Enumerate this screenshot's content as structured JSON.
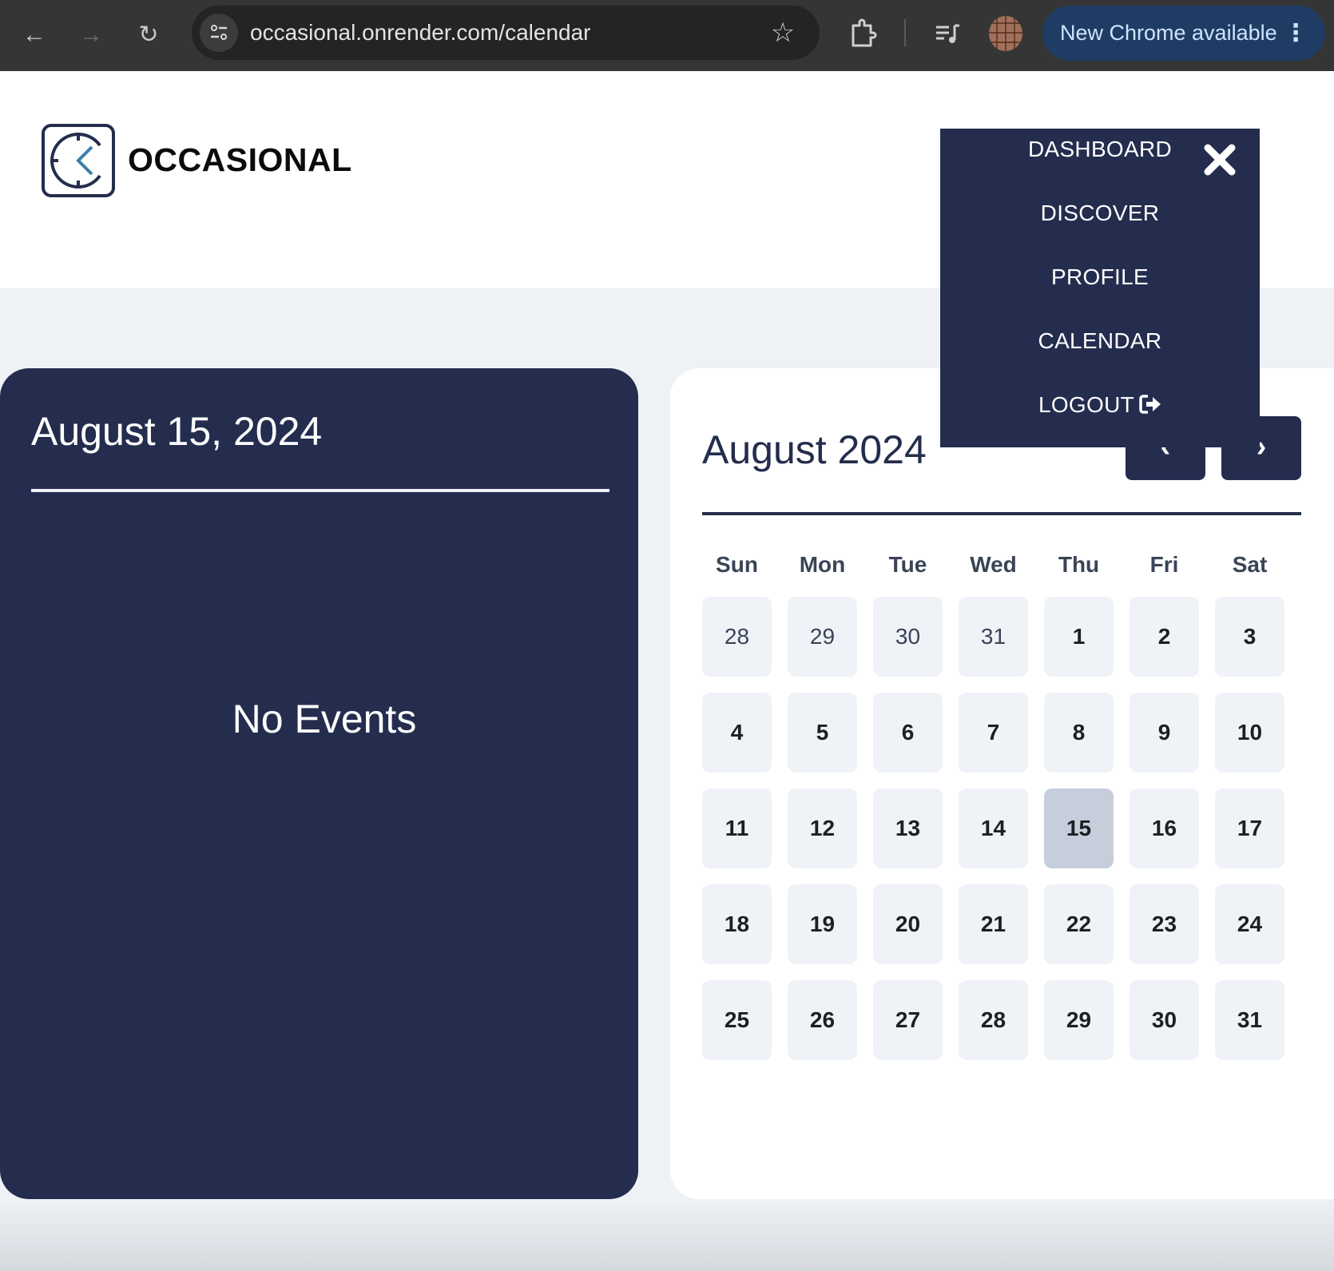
{
  "browser": {
    "url": "occasional.onrender.com/calendar",
    "update_label": "New Chrome available",
    "icons": [
      "back-icon",
      "forward-icon",
      "reload-icon",
      "site-info-icon",
      "bookmark-star-icon",
      "extensions-icon",
      "media-control-icon",
      "profile-avatar",
      "more-icon"
    ]
  },
  "header": {
    "brand": "OCCASIONAL"
  },
  "menu": {
    "items": [
      {
        "label": "DASHBOARD"
      },
      {
        "label": "DISCOVER"
      },
      {
        "label": "PROFILE"
      },
      {
        "label": "CALENDAR"
      },
      {
        "label": "LOGOUT"
      }
    ],
    "close_icon": "close-icon",
    "logout_icon": "sign-out-icon"
  },
  "day_panel": {
    "selected_date": "August 15, 2024",
    "empty_message": "No Events"
  },
  "calendar": {
    "month_title": "August 2024",
    "prev_label": "‹",
    "next_label": "›",
    "weekdays": [
      "Sun",
      "Mon",
      "Tue",
      "Wed",
      "Thu",
      "Fri",
      "Sat"
    ],
    "selected_day": 15,
    "weeks": [
      [
        {
          "d": "28",
          "out": true
        },
        {
          "d": "29",
          "out": true
        },
        {
          "d": "30",
          "out": true
        },
        {
          "d": "31",
          "out": true
        },
        {
          "d": "1"
        },
        {
          "d": "2"
        },
        {
          "d": "3"
        }
      ],
      [
        {
          "d": "4"
        },
        {
          "d": "5"
        },
        {
          "d": "6"
        },
        {
          "d": "7"
        },
        {
          "d": "8"
        },
        {
          "d": "9"
        },
        {
          "d": "10"
        }
      ],
      [
        {
          "d": "11"
        },
        {
          "d": "12"
        },
        {
          "d": "13"
        },
        {
          "d": "14"
        },
        {
          "d": "15"
        },
        {
          "d": "16"
        },
        {
          "d": "17"
        }
      ],
      [
        {
          "d": "18"
        },
        {
          "d": "19"
        },
        {
          "d": "20"
        },
        {
          "d": "21"
        },
        {
          "d": "22"
        },
        {
          "d": "23"
        },
        {
          "d": "24"
        }
      ],
      [
        {
          "d": "25"
        },
        {
          "d": "26"
        },
        {
          "d": "27"
        },
        {
          "d": "28"
        },
        {
          "d": "29"
        },
        {
          "d": "30"
        },
        {
          "d": "31"
        }
      ]
    ]
  },
  "colors": {
    "navy": "#242d4e",
    "page_bg": "#eef2f7",
    "cell_bg": "#eff2f7",
    "selected_cell": "#c6cedc",
    "logo_accent": "#3f7ea6"
  }
}
